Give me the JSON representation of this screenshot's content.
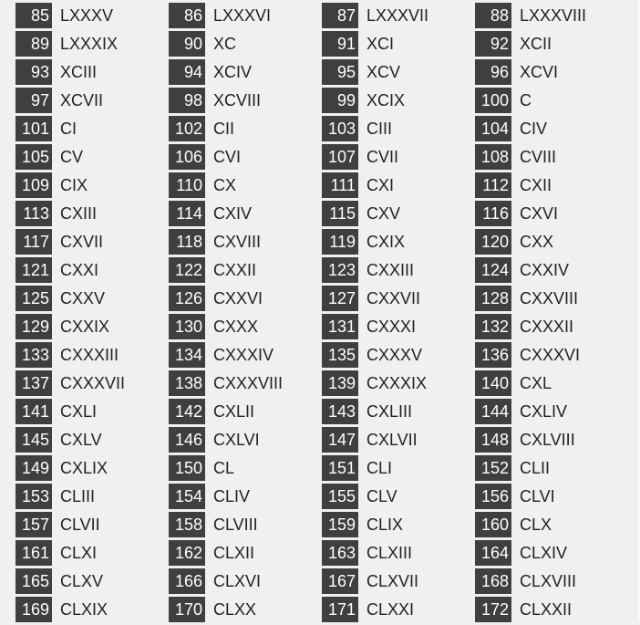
{
  "items": [
    {
      "number": "85",
      "roman": "LXXXV"
    },
    {
      "number": "86",
      "roman": "LXXXVI"
    },
    {
      "number": "87",
      "roman": "LXXXVII"
    },
    {
      "number": "88",
      "roman": "LXXXVIII"
    },
    {
      "number": "89",
      "roman": "LXXXIX"
    },
    {
      "number": "90",
      "roman": "XC"
    },
    {
      "number": "91",
      "roman": "XCI"
    },
    {
      "number": "92",
      "roman": "XCII"
    },
    {
      "number": "93",
      "roman": "XCIII"
    },
    {
      "number": "94",
      "roman": "XCIV"
    },
    {
      "number": "95",
      "roman": "XCV"
    },
    {
      "number": "96",
      "roman": "XCVI"
    },
    {
      "number": "97",
      "roman": "XCVII"
    },
    {
      "number": "98",
      "roman": "XCVIII"
    },
    {
      "number": "99",
      "roman": "XCIX"
    },
    {
      "number": "100",
      "roman": "C"
    },
    {
      "number": "101",
      "roman": "CI"
    },
    {
      "number": "102",
      "roman": "CII"
    },
    {
      "number": "103",
      "roman": "CIII"
    },
    {
      "number": "104",
      "roman": "CIV"
    },
    {
      "number": "105",
      "roman": "CV"
    },
    {
      "number": "106",
      "roman": "CVI"
    },
    {
      "number": "107",
      "roman": "CVII"
    },
    {
      "number": "108",
      "roman": "CVIII"
    },
    {
      "number": "109",
      "roman": "CIX"
    },
    {
      "number": "110",
      "roman": "CX"
    },
    {
      "number": "111",
      "roman": "CXI"
    },
    {
      "number": "112",
      "roman": "CXII"
    },
    {
      "number": "113",
      "roman": "CXIII"
    },
    {
      "number": "114",
      "roman": "CXIV"
    },
    {
      "number": "115",
      "roman": "CXV"
    },
    {
      "number": "116",
      "roman": "CXVI"
    },
    {
      "number": "117",
      "roman": "CXVII"
    },
    {
      "number": "118",
      "roman": "CXVIII"
    },
    {
      "number": "119",
      "roman": "CXIX"
    },
    {
      "number": "120",
      "roman": "CXX"
    },
    {
      "number": "121",
      "roman": "CXXI"
    },
    {
      "number": "122",
      "roman": "CXXII"
    },
    {
      "number": "123",
      "roman": "CXXIII"
    },
    {
      "number": "124",
      "roman": "CXXIV"
    },
    {
      "number": "125",
      "roman": "CXXV"
    },
    {
      "number": "126",
      "roman": "CXXVI"
    },
    {
      "number": "127",
      "roman": "CXXVII"
    },
    {
      "number": "128",
      "roman": "CXXVIII"
    },
    {
      "number": "129",
      "roman": "CXXIX"
    },
    {
      "number": "130",
      "roman": "CXXX"
    },
    {
      "number": "131",
      "roman": "CXXXI"
    },
    {
      "number": "132",
      "roman": "CXXXII"
    },
    {
      "number": "133",
      "roman": "CXXXIII"
    },
    {
      "number": "134",
      "roman": "CXXXIV"
    },
    {
      "number": "135",
      "roman": "CXXXV"
    },
    {
      "number": "136",
      "roman": "CXXXVI"
    },
    {
      "number": "137",
      "roman": "CXXXVII"
    },
    {
      "number": "138",
      "roman": "CXXXVIII"
    },
    {
      "number": "139",
      "roman": "CXXXIX"
    },
    {
      "number": "140",
      "roman": "CXL"
    },
    {
      "number": "141",
      "roman": "CXLI"
    },
    {
      "number": "142",
      "roman": "CXLII"
    },
    {
      "number": "143",
      "roman": "CXLIII"
    },
    {
      "number": "144",
      "roman": "CXLIV"
    },
    {
      "number": "145",
      "roman": "CXLV"
    },
    {
      "number": "146",
      "roman": "CXLVI"
    },
    {
      "number": "147",
      "roman": "CXLVII"
    },
    {
      "number": "148",
      "roman": "CXLVIII"
    },
    {
      "number": "149",
      "roman": "CXLIX"
    },
    {
      "number": "150",
      "roman": "CL"
    },
    {
      "number": "151",
      "roman": "CLI"
    },
    {
      "number": "152",
      "roman": "CLII"
    },
    {
      "number": "153",
      "roman": "CLIII"
    },
    {
      "number": "154",
      "roman": "CLIV"
    },
    {
      "number": "155",
      "roman": "CLV"
    },
    {
      "number": "156",
      "roman": "CLVI"
    },
    {
      "number": "157",
      "roman": "CLVII"
    },
    {
      "number": "158",
      "roman": "CLVIII"
    },
    {
      "number": "159",
      "roman": "CLIX"
    },
    {
      "number": "160",
      "roman": "CLX"
    },
    {
      "number": "161",
      "roman": "CLXI"
    },
    {
      "number": "162",
      "roman": "CLXII"
    },
    {
      "number": "163",
      "roman": "CLXIII"
    },
    {
      "number": "164",
      "roman": "CLXIV"
    },
    {
      "number": "165",
      "roman": "CLXV"
    },
    {
      "number": "166",
      "roman": "CLXVI"
    },
    {
      "number": "167",
      "roman": "CLXVII"
    },
    {
      "number": "168",
      "roman": "CLXVIII"
    },
    {
      "number": "169",
      "roman": "CLXIX"
    },
    {
      "number": "170",
      "roman": "CLXX"
    },
    {
      "number": "171",
      "roman": "CLXXI"
    },
    {
      "number": "172",
      "roman": "CLXXII"
    }
  ]
}
